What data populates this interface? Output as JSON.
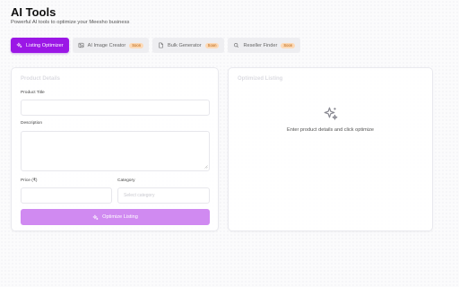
{
  "header": {
    "title": "AI Tools",
    "subtitle": "Powerful AI tools to optimize your Meesho business"
  },
  "tabs": [
    {
      "label": "Listing Optimizer",
      "icon": "sparkles-icon",
      "active": true,
      "badge": ""
    },
    {
      "label": "AI Image Creator",
      "icon": "image-icon",
      "active": false,
      "badge": "Soon"
    },
    {
      "label": "Bulk Generator",
      "icon": "file-icon",
      "active": false,
      "badge": "Soon"
    },
    {
      "label": "Reseller Finder",
      "icon": "search-icon",
      "active": false,
      "badge": "Soon"
    }
  ],
  "form": {
    "title": "Product Details",
    "product_title_label": "Product Title",
    "product_title_placeholder": "",
    "description_label": "Description",
    "description_placeholder": "",
    "price_label": "Price (₹)",
    "price_placeholder": "",
    "category_label": "Category",
    "category_value": "Select category",
    "submit_label": "Optimize Listing"
  },
  "result": {
    "title": "Optimized Listing",
    "empty_message": "Enter product details and click optimize"
  },
  "colors": {
    "accent": "#9b17e6",
    "button_disabled": "#d08af1",
    "badge_bg": "#fdd9b5",
    "badge_text": "#b35a00"
  }
}
